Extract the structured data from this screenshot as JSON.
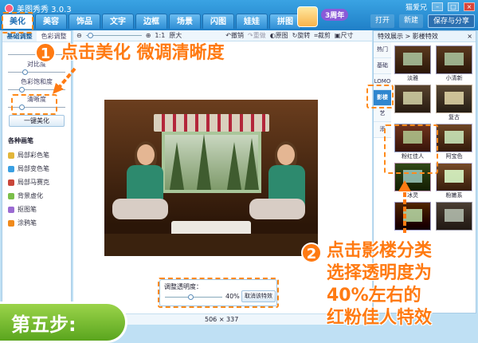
{
  "app": {
    "title": "美图秀秀 3.0.3",
    "user": "猫爱兄",
    "anniversary": "3周年"
  },
  "tabs": [
    "美化",
    "美容",
    "饰品",
    "文字",
    "边框",
    "场景",
    "闪图",
    "娃娃",
    "拼图"
  ],
  "actions": {
    "open": "打开",
    "new": "新建",
    "save_share": "保存与分享"
  },
  "left": {
    "subtabs": [
      "基础调整",
      "色彩调整"
    ],
    "sliders": [
      {
        "label": "对比度",
        "value": 0.25
      },
      {
        "label": "色彩饱和度",
        "value": 0.2
      },
      {
        "label": "清晰度",
        "value": 0.2
      }
    ],
    "one_key": "一键美化",
    "brush_title": "各种画笔",
    "brushes": [
      {
        "label": "局部彩色笔",
        "color": "#e2b63a"
      },
      {
        "label": "局部变色笔",
        "color": "#3aa0e2"
      },
      {
        "label": "局部马赛克",
        "color": "#c9463a"
      },
      {
        "label": "背景虚化",
        "color": "#7bbf4a"
      },
      {
        "label": "抠图笔",
        "color": "#9b6bd2"
      },
      {
        "label": "涂鸦笔",
        "color": "#f08a1c"
      }
    ]
  },
  "toolbar": {
    "zoom_ratio": "1:1",
    "original_size": "原大",
    "undo": "撤销",
    "redo": "重做",
    "original": "原图",
    "rotate": "旋转",
    "crop": "裁剪",
    "size": "尺寸"
  },
  "adjust": {
    "label": "调整透明度：",
    "value": "40%",
    "value_fraction": 0.4,
    "cancel": "取消该特效"
  },
  "status": {
    "dimensions": "506 × 337"
  },
  "right": {
    "header": "特效展示 > 影楼特效",
    "categories": [
      "热门",
      "基础",
      "LOMO",
      "影楼",
      "艺",
      "添"
    ],
    "active_category": 3,
    "thumbs": [
      "淡雅",
      "小清新",
      "",
      "复古",
      "粉红佳人",
      "阿宝色",
      "冰灵",
      "粉嫩系",
      "",
      ""
    ]
  },
  "overlay": {
    "step1_num": "1",
    "step1_text": "点击美化 微调清晰度",
    "step2_num": "2",
    "step2_lines": [
      "点击影楼分类",
      "选择透明度为",
      "40%左右的",
      "红粉佳人特效"
    ],
    "step_badge": "第五步:",
    "accent": "#ff7a12"
  }
}
